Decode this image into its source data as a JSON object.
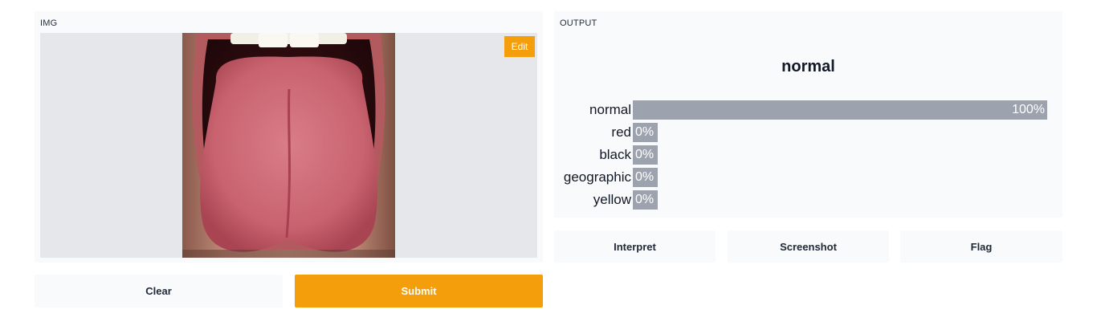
{
  "input": {
    "label": "IMG",
    "edit_label": "Edit",
    "image_icon": "tongue-photo"
  },
  "buttons": {
    "clear": "Clear",
    "submit": "Submit",
    "interpret": "Interpret",
    "screenshot": "Screenshot",
    "flag": "Flag"
  },
  "output": {
    "label": "OUTPUT",
    "top_label": "normal",
    "confidences": [
      {
        "label": "normal",
        "value": 1.0,
        "pct": "100%"
      },
      {
        "label": "red",
        "value": 0.0,
        "pct": "0%"
      },
      {
        "label": "black",
        "value": 0.0,
        "pct": "0%"
      },
      {
        "label": "geographic",
        "value": 0.0,
        "pct": "0%"
      },
      {
        "label": "yellow",
        "value": 0.0,
        "pct": "0%"
      }
    ]
  },
  "colors": {
    "accent": "#f59e0b",
    "bar": "#9ca3af",
    "panel_bg": "#f9fafb",
    "image_bg": "#e5e7eb"
  }
}
